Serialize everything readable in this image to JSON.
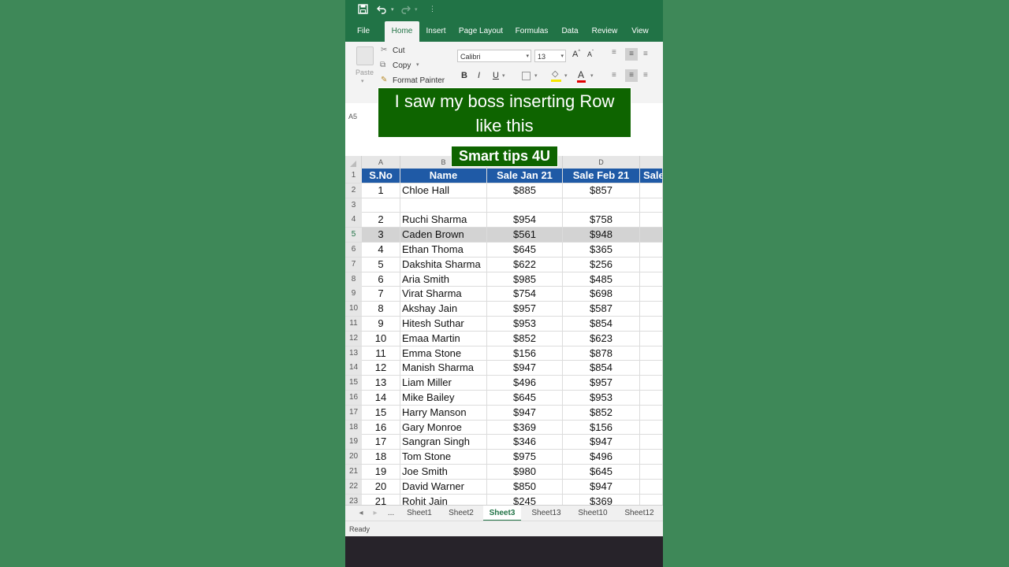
{
  "qat": {
    "save_icon": "save-icon",
    "undo_icon": "undo-icon",
    "redo_icon": "redo-icon",
    "customize_icon": "customize-icon"
  },
  "ribbon_tabs": [
    "File",
    "Home",
    "Insert",
    "Page Layout",
    "Formulas",
    "Data",
    "Review",
    "View"
  ],
  "active_tab": "Home",
  "clipboard": {
    "paste": "Paste",
    "cut": "Cut",
    "copy": "Copy",
    "format_painter": "Format Painter"
  },
  "font": {
    "name": "Calibri",
    "size": "13",
    "bold": "B",
    "italic": "I",
    "underline": "U",
    "grow": "A",
    "shrink": "A",
    "font_color": "A"
  },
  "name_box": "A5",
  "overlay": {
    "line1": "I saw my boss inserting Row",
    "line2": "like this",
    "badge": "Smart tips 4U"
  },
  "columns": [
    "A",
    "B",
    "D"
  ],
  "header_row": {
    "rownum": "1",
    "a": "S.No",
    "b": "Name",
    "c": "Sale Jan 21",
    "d": "Sale Feb 21",
    "e": "Sale"
  },
  "rows": [
    {
      "n": "2",
      "a": "1",
      "b": "Chloe Hall",
      "c": "$885",
      "d": "$857"
    },
    {
      "n": "3",
      "a": "",
      "b": "",
      "c": "",
      "d": ""
    },
    {
      "n": "4",
      "a": "2",
      "b": "Ruchi Sharma",
      "c": "$954",
      "d": "$758"
    },
    {
      "n": "5",
      "a": "3",
      "b": "Caden Brown",
      "c": "$561",
      "d": "$948"
    },
    {
      "n": "6",
      "a": "4",
      "b": "Ethan Thoma",
      "c": "$645",
      "d": "$365"
    },
    {
      "n": "7",
      "a": "5",
      "b": "Dakshita Sharma",
      "c": "$622",
      "d": "$256"
    },
    {
      "n": "8",
      "a": "6",
      "b": "Aria Smith",
      "c": "$985",
      "d": "$485"
    },
    {
      "n": "9",
      "a": "7",
      "b": "Virat Sharma",
      "c": "$754",
      "d": "$698"
    },
    {
      "n": "10",
      "a": "8",
      "b": "Akshay Jain",
      "c": "$957",
      "d": "$587"
    },
    {
      "n": "11",
      "a": "9",
      "b": "Hitesh Suthar",
      "c": "$953",
      "d": "$854"
    },
    {
      "n": "12",
      "a": "10",
      "b": "Emaa Martin",
      "c": "$852",
      "d": "$623"
    },
    {
      "n": "13",
      "a": "11",
      "b": "Emma Stone",
      "c": "$156",
      "d": "$878"
    },
    {
      "n": "14",
      "a": "12",
      "b": "Manish Sharma",
      "c": "$947",
      "d": "$854"
    },
    {
      "n": "15",
      "a": "13",
      "b": "Liam Miller",
      "c": "$496",
      "d": "$957"
    },
    {
      "n": "16",
      "a": "14",
      "b": "Mike Bailey",
      "c": "$645",
      "d": "$953"
    },
    {
      "n": "17",
      "a": "15",
      "b": "Harry Manson",
      "c": "$947",
      "d": "$852"
    },
    {
      "n": "18",
      "a": "16",
      "b": "Gary Monroe",
      "c": "$369",
      "d": "$156"
    },
    {
      "n": "19",
      "a": "17",
      "b": "Sangran Singh",
      "c": "$346",
      "d": "$947"
    },
    {
      "n": "20",
      "a": "18",
      "b": "Tom Stone",
      "c": "$975",
      "d": "$496"
    },
    {
      "n": "21",
      "a": "19",
      "b": "Joe Smith",
      "c": "$980",
      "d": "$645"
    },
    {
      "n": "22",
      "a": "20",
      "b": "David Warner",
      "c": "$850",
      "d": "$947"
    },
    {
      "n": "23",
      "a": "21",
      "b": "Rohit Jain",
      "c": "$245",
      "d": "$369"
    }
  ],
  "selected_row": "5",
  "sheet_tabs": [
    "Sheet1",
    "Sheet2",
    "Sheet3",
    "Sheet13",
    "Sheet10",
    "Sheet12"
  ],
  "active_sheet": "Sheet3",
  "sheet_nav": {
    "prev": "◂",
    "next": "▸",
    "more": "..."
  },
  "status": "Ready",
  "colors": {
    "excel_green": "#217346",
    "header_blue": "#1f5aa6",
    "overlay_green": "#0e6400",
    "background": "#3e8858"
  }
}
